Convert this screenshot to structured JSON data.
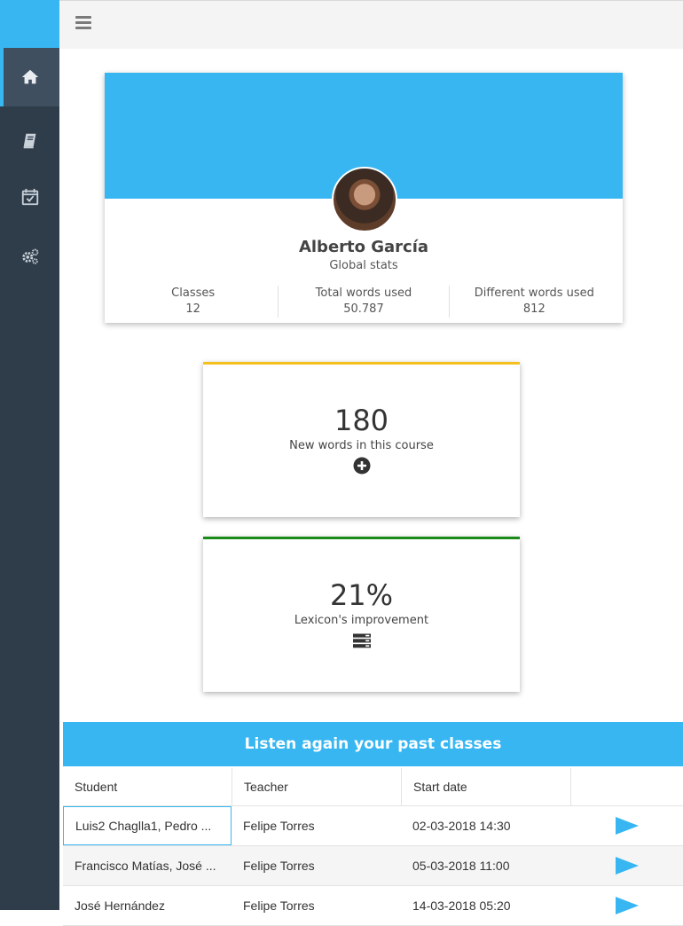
{
  "sidebar": {
    "items": [
      {
        "icon": "home-icon",
        "active": true
      },
      {
        "icon": "book-icon",
        "active": false
      },
      {
        "icon": "calendar-check-icon",
        "active": false
      },
      {
        "icon": "gears-icon",
        "active": false
      }
    ]
  },
  "header": {
    "menu_icon": "hamburger-menu-icon"
  },
  "profile": {
    "name": "Alberto García",
    "subtitle": "Global stats",
    "stats": [
      {
        "label": "Classes",
        "value": "12"
      },
      {
        "label": "Total words used",
        "value": "50.787"
      },
      {
        "label": "Different words used",
        "value": "812"
      }
    ]
  },
  "metrics": [
    {
      "value": "180",
      "label": "New words in this course",
      "icon": "plus-circle-icon",
      "color": "#f5c01d"
    },
    {
      "value": "21%",
      "label": "Lexicon's improvement",
      "icon": "server-icon",
      "color": "#1a8a1a"
    }
  ],
  "past_classes": {
    "title": "Listen again your past classes",
    "columns": [
      "Student",
      "Teacher",
      "Start date",
      ""
    ],
    "rows": [
      {
        "student": "Luis2 Chaglla1, Pedro ...",
        "teacher": "Felipe Torres",
        "start": "02-03-2018 14:30"
      },
      {
        "student": "Francisco Matías, José ...",
        "teacher": "Felipe Torres",
        "start": "05-03-2018 11:00"
      },
      {
        "student": "José Hernández",
        "teacher": "Felipe Torres",
        "start": "14-03-2018 05:20"
      }
    ]
  },
  "colors": {
    "accent": "#38b6f1",
    "sidebar": "#2f3d4b"
  }
}
